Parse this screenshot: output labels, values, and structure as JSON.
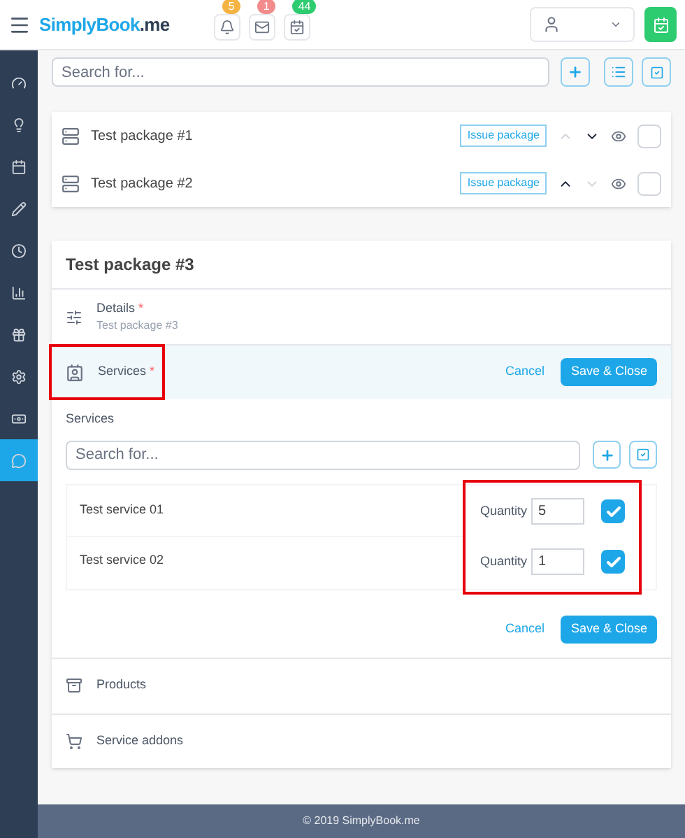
{
  "header": {
    "logo_prefix": "S",
    "logo_main": "implyBook",
    "logo_suffix": ".me",
    "badges": [
      {
        "kind": "bell",
        "count": "5",
        "color": "#f5b342"
      },
      {
        "kind": "mail",
        "count": "1",
        "color": "#f28b8b"
      },
      {
        "kind": "tasks",
        "count": "44",
        "color": "#2ecc71"
      }
    ]
  },
  "sidebar": {
    "items": [
      {
        "kind": "dashboard",
        "selected": false
      },
      {
        "kind": "idea",
        "selected": false
      },
      {
        "kind": "calendar",
        "selected": false
      },
      {
        "kind": "pencil",
        "selected": false
      },
      {
        "kind": "clock",
        "selected": false
      },
      {
        "kind": "chart",
        "selected": false
      },
      {
        "kind": "gift",
        "selected": false
      },
      {
        "kind": "settings",
        "selected": false
      },
      {
        "kind": "money",
        "selected": false
      },
      {
        "kind": "chat",
        "selected": true
      }
    ]
  },
  "search": {
    "placeholder": "Search for..."
  },
  "packages": [
    {
      "name": "Test package #1",
      "action": "Issue package",
      "up_enabled": false,
      "down_enabled": true,
      "checked": false
    },
    {
      "name": "Test package #2",
      "action": "Issue package",
      "up_enabled": true,
      "down_enabled": false,
      "checked": false
    }
  ],
  "form": {
    "title": "Test package #3",
    "details": {
      "label": "Details",
      "required_mark": "*",
      "value": "Test package #3"
    },
    "services": {
      "label": "Services",
      "required_mark": "*",
      "highlighted": true,
      "cancel": "Cancel",
      "save": "Save & Close",
      "field_label": "Services",
      "search_placeholder": "Search for...",
      "quantity_highlighted": true,
      "items": [
        {
          "name": "Test service 01",
          "quantity_label": "Quantity",
          "quantity": "5",
          "checked": true
        },
        {
          "name": "Test service 02",
          "quantity_label": "Quantity",
          "quantity": "1",
          "checked": true
        }
      ],
      "bottom_cancel": "Cancel",
      "bottom_save": "Save & Close"
    },
    "sections": [
      {
        "kind": "products",
        "label": "Products"
      },
      {
        "kind": "addons",
        "label": "Service addons"
      }
    ]
  },
  "footer": "© 2019 SimplyBook.me"
}
